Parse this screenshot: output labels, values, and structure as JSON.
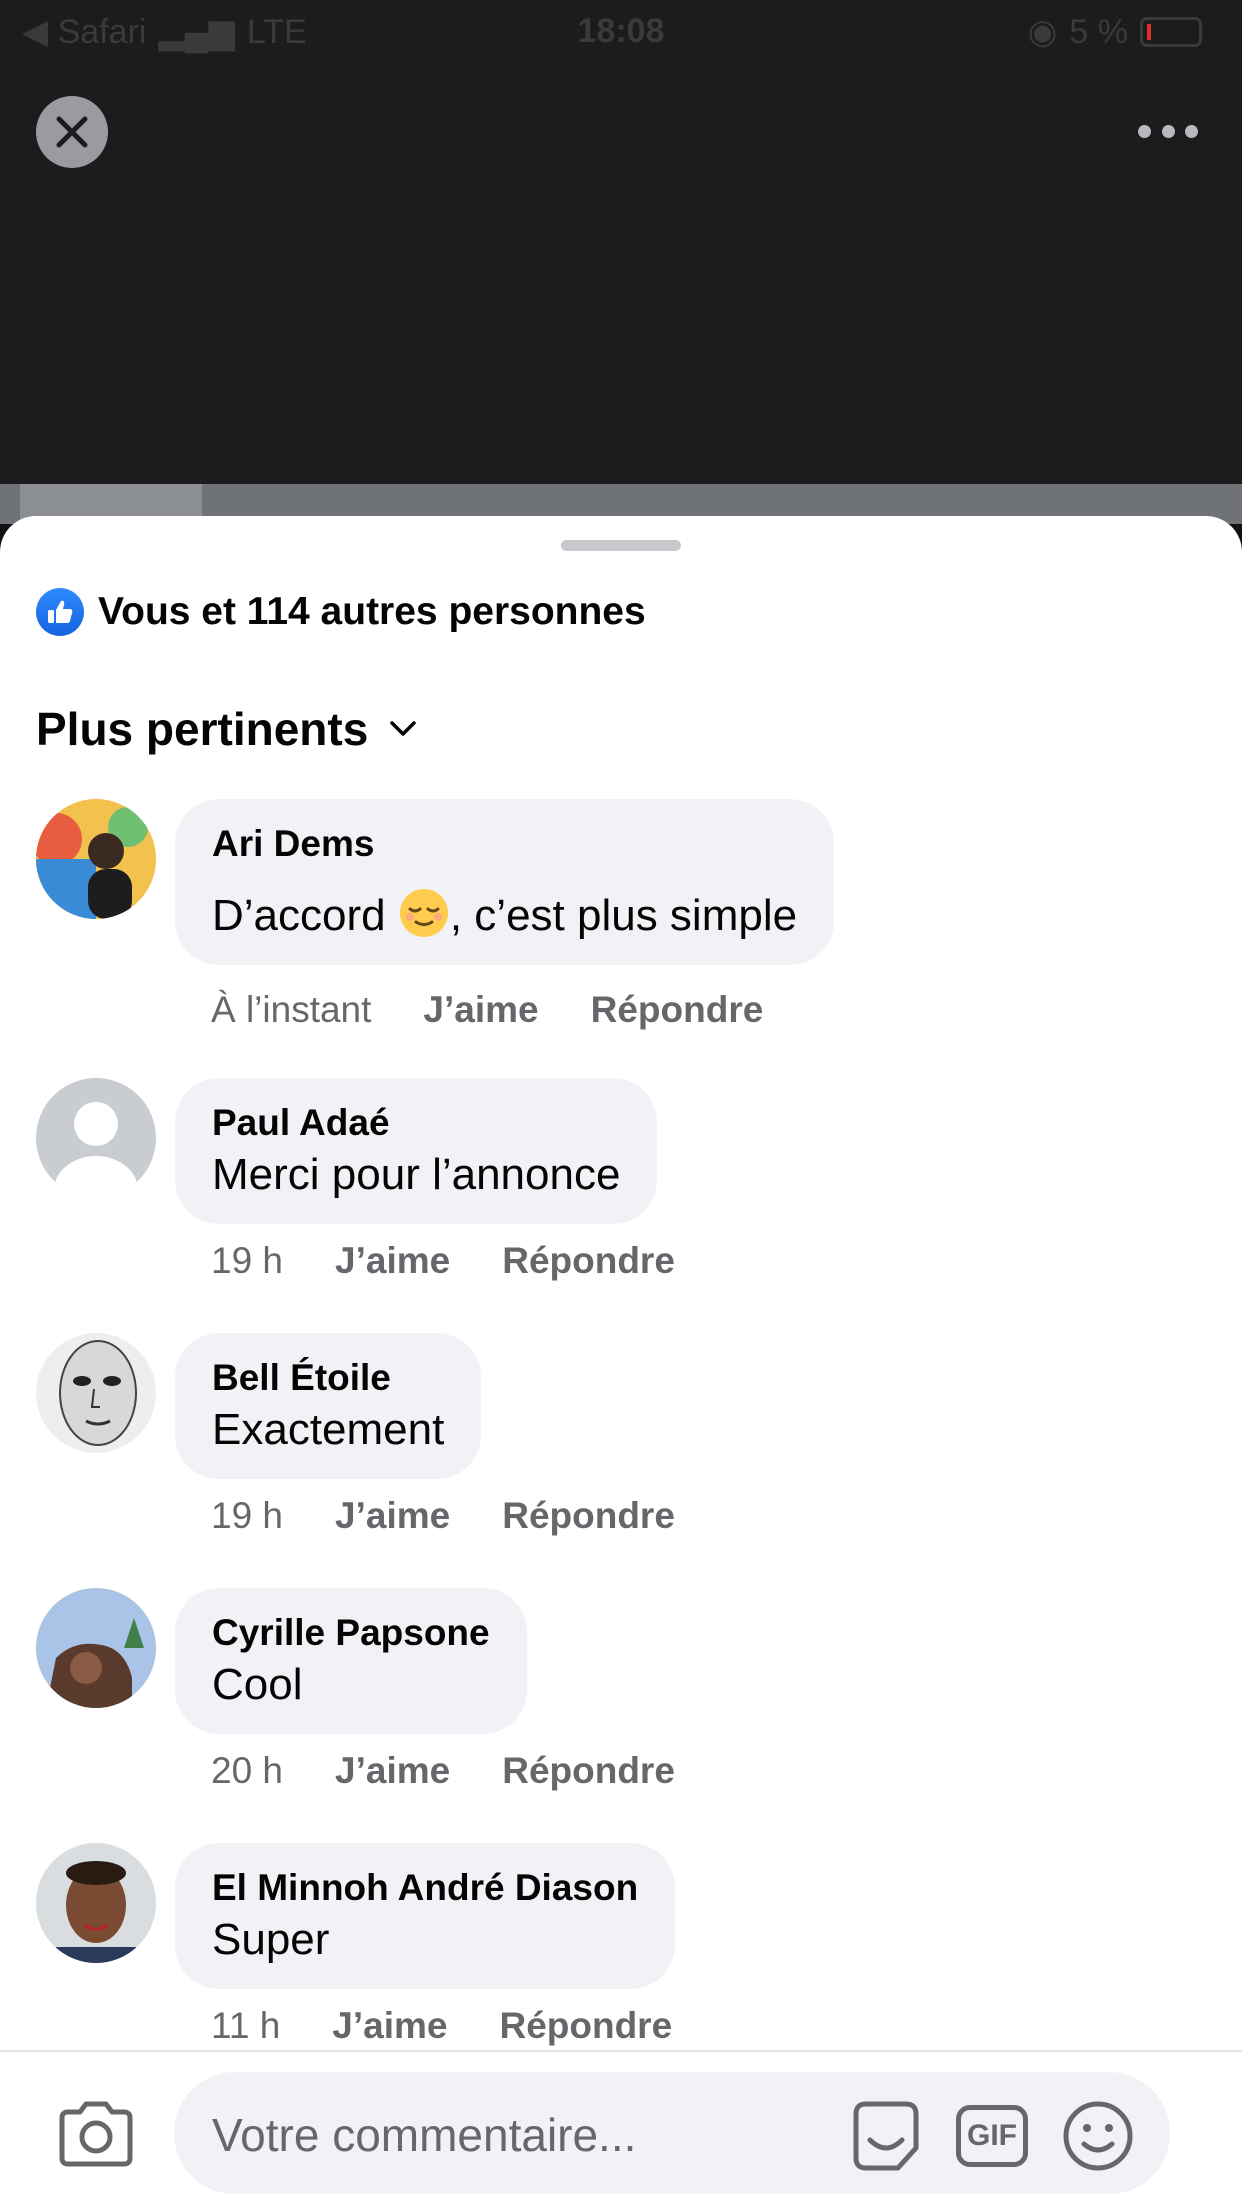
{
  "status_bar": {
    "back_app": "◀ Safari",
    "network": "LTE",
    "time": "18:08",
    "battery": "5 %"
  },
  "top_bar": {
    "close_icon": "close-icon",
    "more_icon": "more-icon"
  },
  "likes": {
    "text": "Vous et 114 autres personnes",
    "icon": "thumbs-up-icon",
    "color": "#1877f2"
  },
  "sort": {
    "label": "Plus pertinents",
    "icon": "chevron-down-icon"
  },
  "comments": [
    {
      "name": "Ari Dems",
      "text_before": "D’accord ",
      "emoji": "relieved-face-emoji",
      "text_after": ", c’est plus simple",
      "time": "À l’instant",
      "like": "J’aime",
      "reply": "Répondre"
    },
    {
      "name": "Paul Adaé",
      "text": "Merci pour l’annonce",
      "time": "19 h",
      "like": "J’aime",
      "reply": "Répondre"
    },
    {
      "name": "Bell Étoile",
      "text": "Exactement",
      "time": "19 h",
      "like": "J’aime",
      "reply": "Répondre"
    },
    {
      "name": "Cyrille Papsone",
      "text": "Cool",
      "time": "20 h",
      "like": "J’aime",
      "reply": "Répondre"
    },
    {
      "name": "El Minnoh André Diason",
      "text": "Super",
      "time": "11 h",
      "like": "J’aime",
      "reply": "Répondre"
    }
  ],
  "composer": {
    "placeholder": "Votre commentaire...",
    "gif": "GIF",
    "icons": [
      "camera-icon",
      "sticker-icon",
      "gif-icon",
      "emoji-icon"
    ]
  }
}
